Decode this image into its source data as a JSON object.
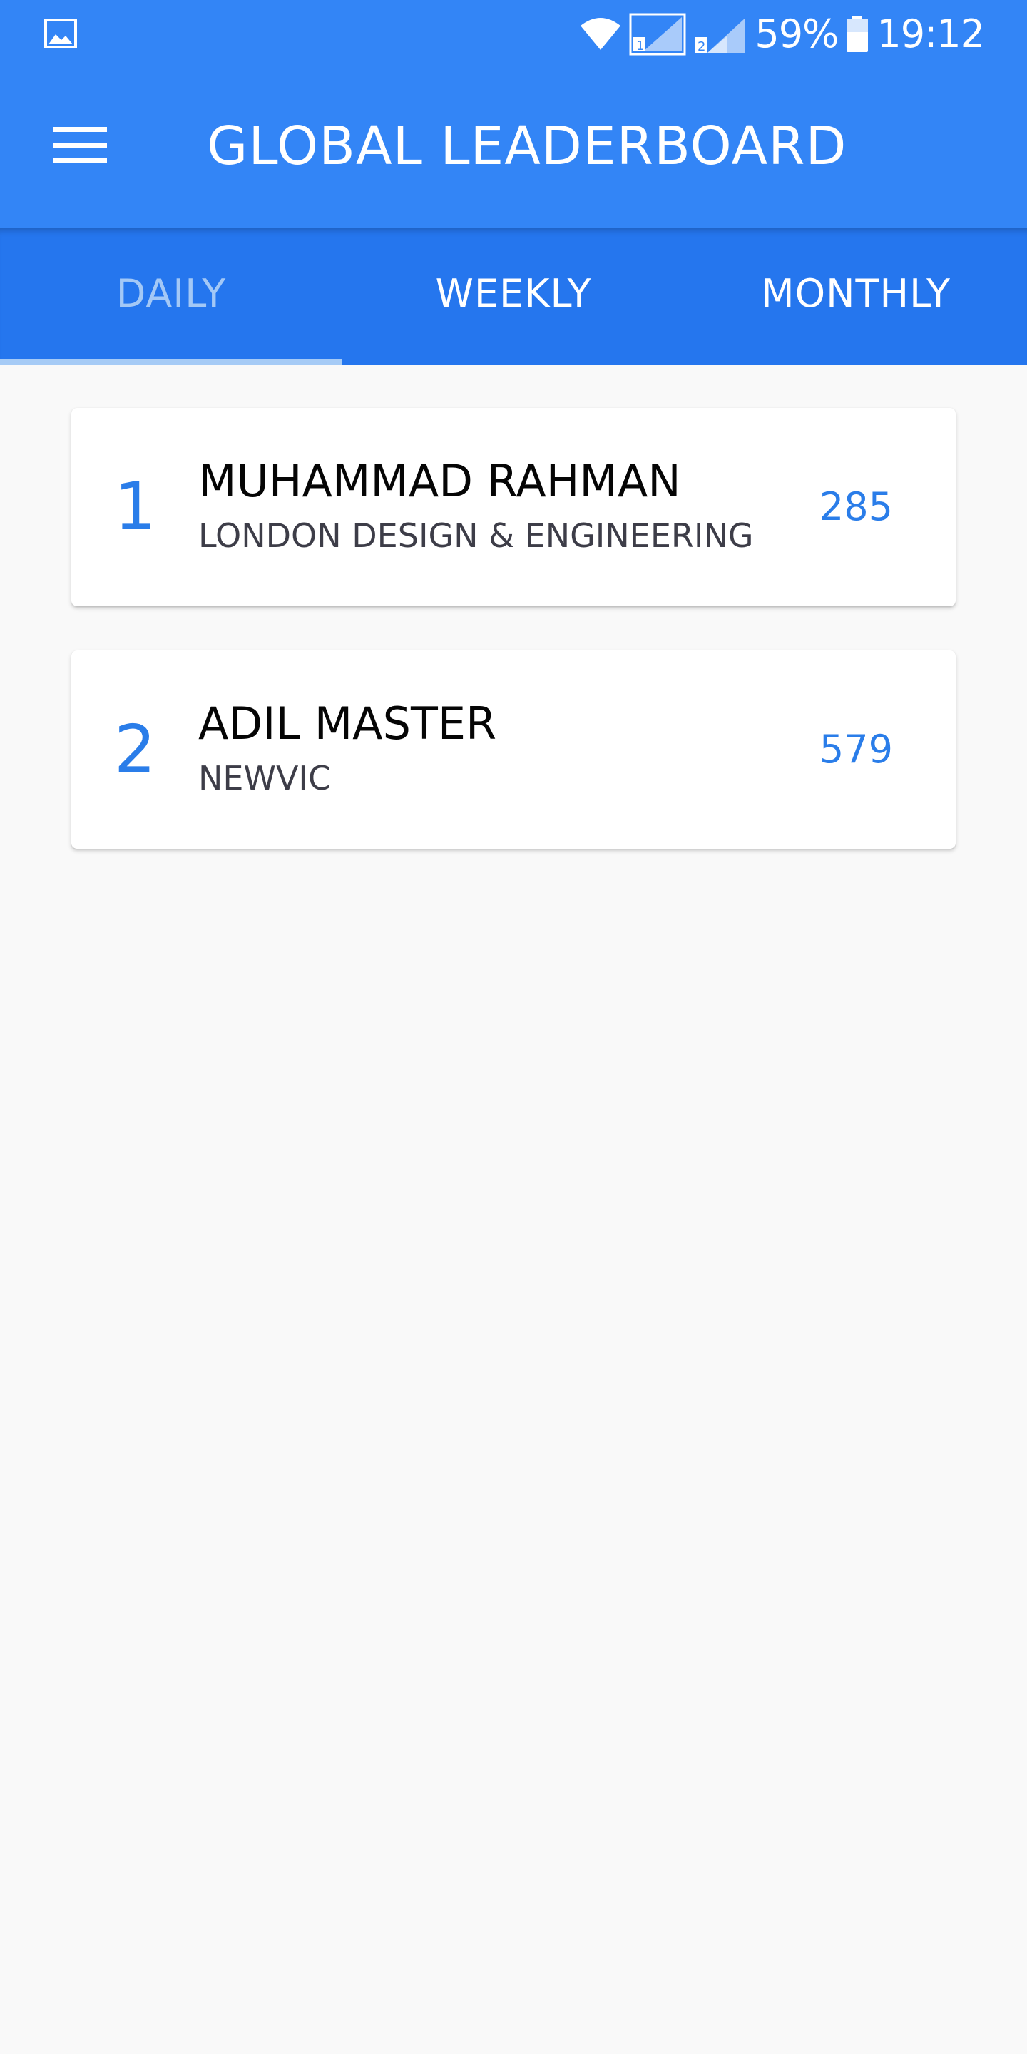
{
  "status_bar": {
    "battery_percent": "59%",
    "time": "19:12",
    "sim1_label": "1",
    "sim2_label": "2",
    "icons": [
      "gallery-icon",
      "wifi-icon",
      "signal-sim1-icon",
      "signal-sim2-icon",
      "battery-icon"
    ]
  },
  "toolbar": {
    "title": "GLOBAL LEADERBOARD",
    "menu_icon": "hamburger-menu-icon"
  },
  "tabs": [
    {
      "label": "DAILY",
      "active": true
    },
    {
      "label": "WEEKLY",
      "active": false
    },
    {
      "label": "MONTHLY",
      "active": false
    }
  ],
  "leaderboard": [
    {
      "rank": "1",
      "name": "MUHAMMAD RAHMAN",
      "organization": "LONDON DESIGN & ENGINEERING",
      "score": "285"
    },
    {
      "rank": "2",
      "name": "ADIL MASTER",
      "organization": "NEWVIC",
      "score": "579"
    }
  ],
  "colors": {
    "primary": "#3385f6",
    "tab_bar": "#2576ee",
    "accent_text": "#2a7de9",
    "active_tab_text": "#a3c8f6",
    "background": "#f9f9f9"
  }
}
